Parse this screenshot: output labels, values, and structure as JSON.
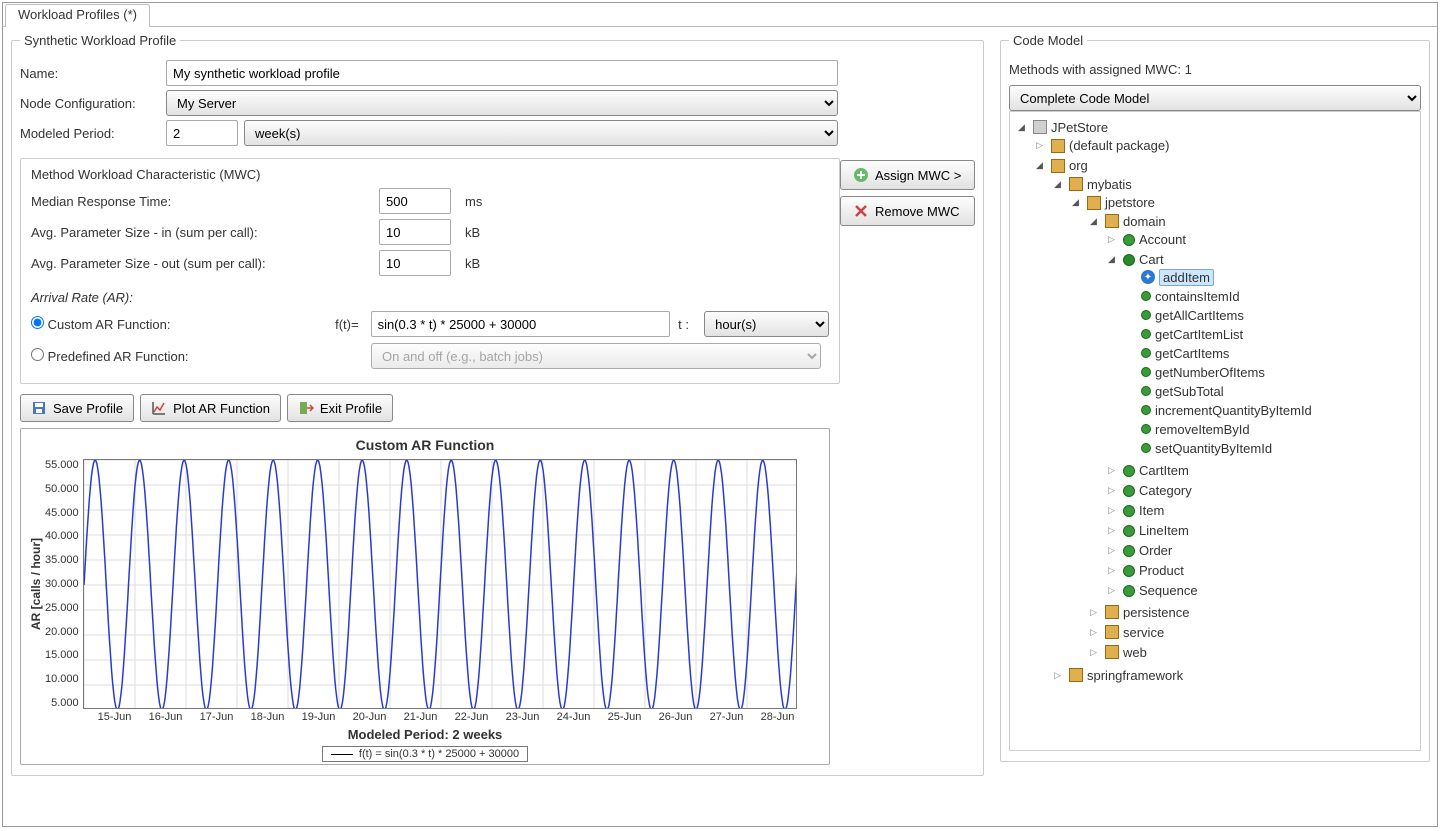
{
  "tab": {
    "label": "Workload Profiles (*)"
  },
  "profile_fieldset": {
    "legend": "Synthetic Workload Profile"
  },
  "form": {
    "name_label": "Name:",
    "name_value": "My synthetic workload profile",
    "nodecfg_label": "Node Configuration:",
    "nodecfg_value": "My Server",
    "period_label": "Modeled Period:",
    "period_value": "2",
    "period_unit": "week(s)"
  },
  "mwc": {
    "legend": "Method Workload Characteristic (MWC)",
    "mrt_label": "Median Response Time:",
    "mrt_value": "500",
    "mrt_unit": "ms",
    "pin_label": "Avg. Parameter Size - in (sum per call):",
    "pin_value": "10",
    "pin_unit": "kB",
    "pout_label": "Avg. Parameter Size - out (sum per call):",
    "pout_value": "10",
    "pout_unit": "kB",
    "ar_title": "Arrival Rate (AR):",
    "custom_label": "Custom AR Function:",
    "ft_label": "f(t)=",
    "ft_value": "sin(0.3 * t) * 25000 + 30000",
    "t_label": "t :",
    "t_unit": "hour(s)",
    "predef_label": "Predefined AR Function:",
    "predef_value": "On and off (e.g., batch jobs)"
  },
  "side_buttons": {
    "assign": "Assign MWC >",
    "remove": "Remove MWC"
  },
  "buttons": {
    "save": "Save Profile",
    "plot": "Plot AR Function",
    "exit": "Exit Profile"
  },
  "chart_data": {
    "type": "line",
    "title": "Custom AR Function",
    "ylabel": "AR  [calls / hour]",
    "xlabel": "Modeled Period: 2 weeks",
    "legend": "f(t) = sin(0.3 * t) * 25000 + 30000",
    "yticks": [
      "55.000",
      "50.000",
      "45.000",
      "40.000",
      "35.000",
      "30.000",
      "25.000",
      "20.000",
      "15.000",
      "10.000",
      "5.000"
    ],
    "xticks": [
      "15-Jun",
      "16-Jun",
      "17-Jun",
      "18-Jun",
      "19-Jun",
      "20-Jun",
      "21-Jun",
      "22-Jun",
      "23-Jun",
      "24-Jun",
      "25-Jun",
      "26-Jun",
      "27-Jun",
      "28-Jun"
    ],
    "ylim": [
      5000,
      55000
    ],
    "xlim_hours": [
      0,
      336
    ],
    "formula": {
      "amp": 25000,
      "offset": 30000,
      "k": 0.3
    }
  },
  "code_model": {
    "legend": "Code Model",
    "status": "Methods with assigned MWC: 1",
    "combo": "Complete Code Model",
    "tree": {
      "root": "JPetStore",
      "default_pkg": "(default package)",
      "org": "org",
      "mybatis": "mybatis",
      "jpetstore": "jpetstore",
      "domain": "domain",
      "Account": "Account",
      "Cart": "Cart",
      "cart_methods": [
        "addItem",
        "containsItemId",
        "getAllCartItems",
        "getCartItemList",
        "getCartItems",
        "getNumberOfItems",
        "getSubTotal",
        "incrementQuantityByItemId",
        "removeItemById",
        "setQuantityByItemId"
      ],
      "CartItem": "CartItem",
      "Category": "Category",
      "Item": "Item",
      "LineItem": "LineItem",
      "Order": "Order",
      "Product": "Product",
      "Sequence": "Sequence",
      "persistence": "persistence",
      "service": "service",
      "web": "web",
      "springframework": "springframework"
    }
  }
}
